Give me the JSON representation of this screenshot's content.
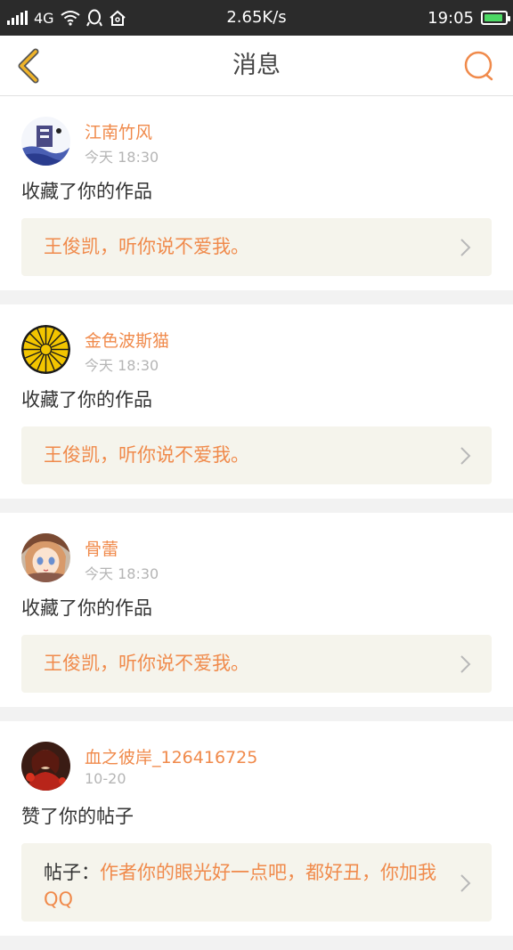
{
  "status_bar": {
    "network": "4G",
    "speed": "2.65K/s",
    "time": "19:05",
    "battery_level": 0.9,
    "signal_bars": 5
  },
  "nav": {
    "title": "消息",
    "back_icon": "chevron-left-icon",
    "search_icon": "search-icon"
  },
  "colors": {
    "accent": "#f08a4b",
    "back_icon": "#f0b429"
  },
  "messages": [
    {
      "user": "江南竹风",
      "time": "今天 18:30",
      "action": "收藏了你的作品",
      "quote_prefix": "",
      "quote": "王俊凯，听你说不爱我。"
    },
    {
      "user": "金色波斯猫",
      "time": "今天 18:30",
      "action": "收藏了你的作品",
      "quote_prefix": "",
      "quote": "王俊凯，听你说不爱我。"
    },
    {
      "user": "骨蕾",
      "time": "今天 18:30",
      "action": "收藏了你的作品",
      "quote_prefix": "",
      "quote": "王俊凯，听你说不爱我。"
    },
    {
      "user": "血之彼岸_126416725",
      "time": "10-20",
      "action": "赞了你的帖子",
      "quote_prefix": "帖子：",
      "quote": "作者你的眼光好一点吧，都好丑，你加我QQ"
    }
  ]
}
